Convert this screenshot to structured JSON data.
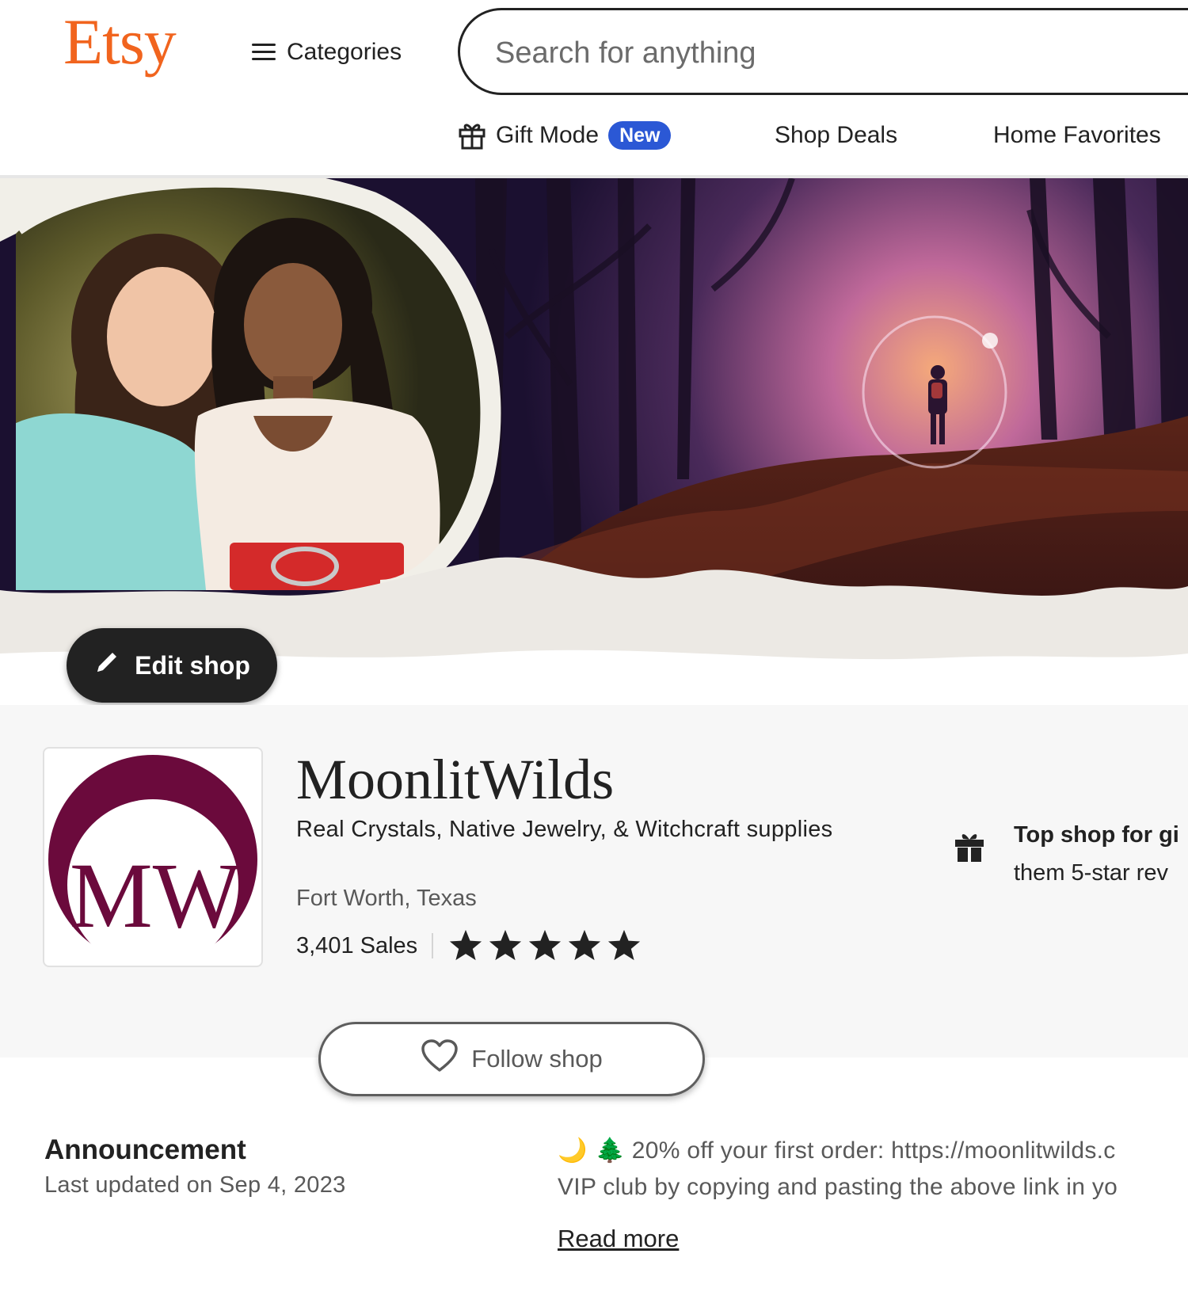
{
  "header": {
    "logo": "Etsy",
    "categories_label": "Categories",
    "search_placeholder": "Search for anything"
  },
  "subnav": {
    "gift_mode_label": "Gift Mode",
    "gift_mode_badge": "New",
    "shop_deals_label": "Shop Deals",
    "home_favorites_label": "Home Favorites"
  },
  "banner": {
    "edit_shop_label": "Edit shop"
  },
  "shop": {
    "name": "MoonlitWilds",
    "logo_monogram": "MW",
    "tagline": "Real Crystals, Native Jewelry, & Witchcraft supplies",
    "location": "Fort Worth, Texas",
    "sales": "3,401 Sales",
    "rating_stars": 5,
    "top_shop_line1": "Top shop for gi",
    "top_shop_line2": "them 5-star rev",
    "follow_label": "Follow shop"
  },
  "announcement": {
    "title": "Announcement",
    "updated": "Last updated on Sep 4, 2023",
    "emoji": "🌙 🌲",
    "line1": "20% off your first order: https://moonlitwilds.c",
    "line2": "VIP club by copying and pasting the above link in yo",
    "read_more": "Read more"
  },
  "colors": {
    "brand": "#f1641e",
    "badge": "#2b58d5",
    "logo_maroon": "#6b0a3c",
    "dark_button": "#222222"
  }
}
